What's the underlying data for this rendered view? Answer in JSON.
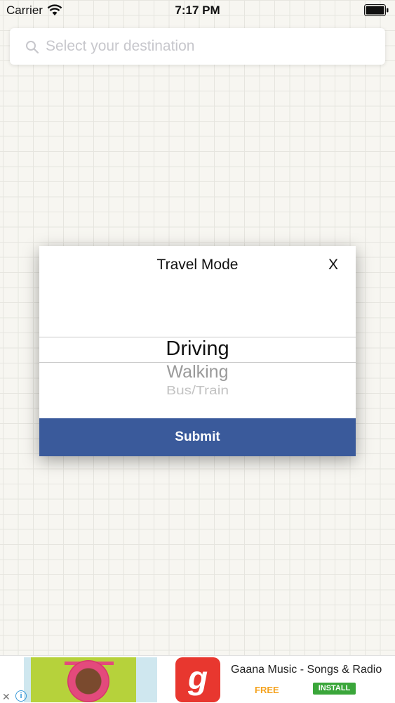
{
  "status_bar": {
    "carrier": "Carrier",
    "time": "7:17 PM",
    "icons": [
      "wifi-icon",
      "battery-icon"
    ]
  },
  "search": {
    "placeholder": "Select your destination",
    "value": "",
    "icon": "search-icon"
  },
  "modal": {
    "title": "Travel Mode",
    "close_label": "X",
    "picker": {
      "options": [
        "Driving",
        "Walking",
        "Bus/Train"
      ],
      "selected": "Driving"
    },
    "submit_label": "Submit",
    "submit_color": "#3a5a9b"
  },
  "ad": {
    "title": "Gaana Music - Songs & Radio",
    "price": "FREE",
    "install_label": "INSTALL",
    "logo_glyph": "g",
    "close_label": "✕",
    "info_label": "i",
    "brand_color": "#e8372f",
    "install_color": "#3aa63a"
  }
}
